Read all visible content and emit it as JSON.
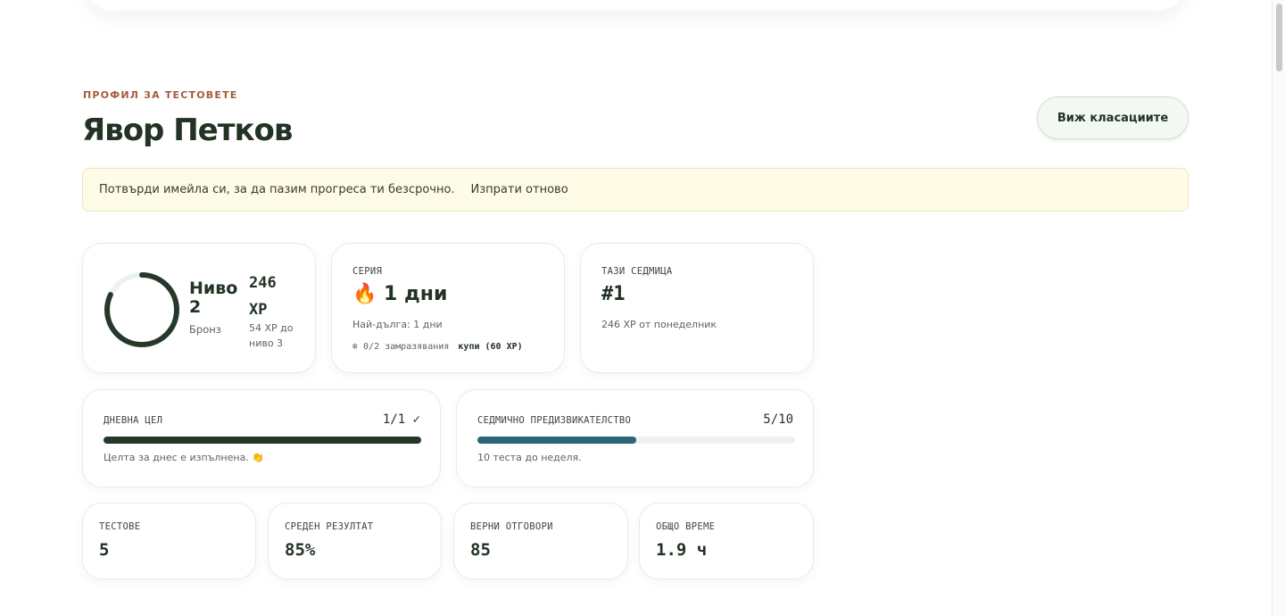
{
  "header": {
    "eyebrow": "ПРОФИЛ ЗА ТЕСТОВЕТЕ",
    "title": "Явор Петков",
    "leaderboard_button": "Виж класациите"
  },
  "banner": {
    "message": "Потвърди имейла си, за да пазим прогреса ти безсрочно.",
    "action": "Изпрати отново"
  },
  "level": {
    "label_line1": "Ниво",
    "label_line2": "2",
    "tier": "Бронз",
    "xp_line1": "246",
    "xp_line2": "XP",
    "xp_note_line1": "54 XP до",
    "xp_note_line2": "ниво 3",
    "ring_progress": 0.82
  },
  "streak": {
    "label": "СЕРИЯ",
    "icon": "fire-icon",
    "value": "🔥 1 дни",
    "longest": "Най-дълга: 1 дни",
    "freezes": "❄ 0/2 замразявания",
    "buy": "купи (60 XP)"
  },
  "week": {
    "label": "ТАЗИ СЕДМИЦА",
    "rank": "#1",
    "note": "246 XP от понеделник"
  },
  "daily_goal": {
    "label": "ДНЕВНА ЦЕЛ",
    "count": "1/1 ✓",
    "progress": 1.0,
    "note": "Целта за днес е изпълнена. 👏"
  },
  "weekly_challenge": {
    "label": "СЕДМИЧНО ПРЕДИЗВИКАТЕЛСТВО",
    "count": "5/10",
    "progress": 0.5,
    "note": "10 теста до неделя."
  },
  "stats": [
    {
      "label": "ТЕСТОВЕ",
      "value": "5"
    },
    {
      "label": "СРЕДЕН РЕЗУЛТАТ",
      "value": "85%"
    },
    {
      "label": "ВЕРНИ ОТГОВОРИ",
      "value": "85"
    },
    {
      "label": "ОБЩО ВРЕМЕ",
      "value": "1.9 ч"
    }
  ],
  "colors": {
    "accent_dark": "#26382a",
    "accent_teal": "#2c6573",
    "eyebrow": "#a45a3d"
  }
}
